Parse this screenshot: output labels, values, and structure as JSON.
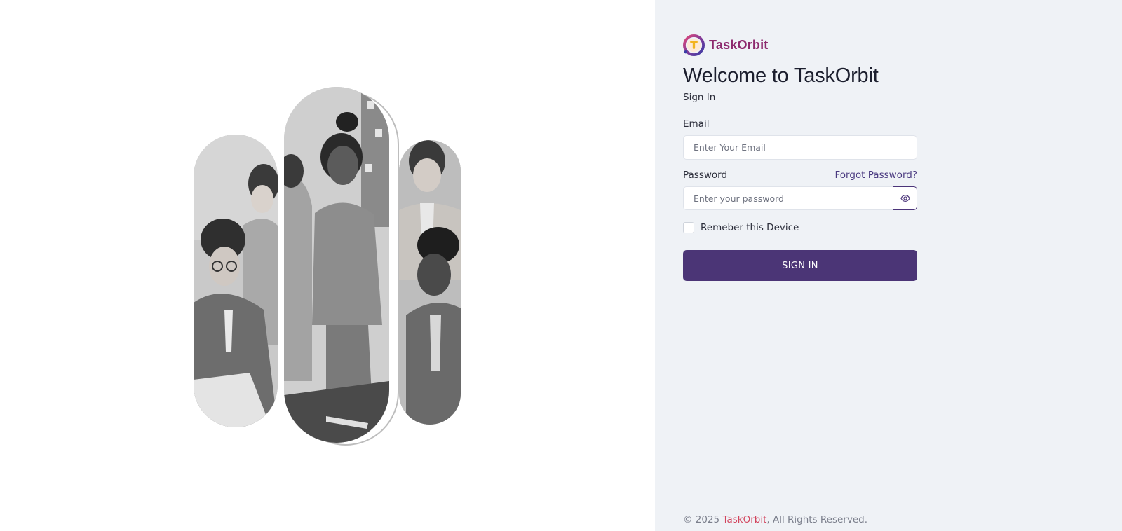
{
  "brand": {
    "name": "TaskOrbit",
    "logo_icon": "taskorbit-logo-icon",
    "name_color": "#8d2a6e"
  },
  "form": {
    "heading": "Welcome to TaskOrbit",
    "subtitle": "Sign In",
    "email": {
      "label": "Email",
      "placeholder": "Enter Your Email",
      "value": ""
    },
    "password": {
      "label": "Password",
      "placeholder": "Enter your password",
      "value": "",
      "toggle_icon": "eye-icon"
    },
    "forgot_label": "Forgot Password?",
    "remember": {
      "label": "Remeber this Device",
      "checked": false
    },
    "submit_label": "SIGN IN"
  },
  "footer": {
    "prefix": "© 2025 ",
    "brand": "TaskOrbit",
    "suffix": ", All Rights Reserved."
  },
  "colors": {
    "primary": "#4b3576",
    "panel_bg": "#eff2f6",
    "footer_brand": "#d2445d"
  },
  "illustration": {
    "icon": "team-photo-collage"
  }
}
